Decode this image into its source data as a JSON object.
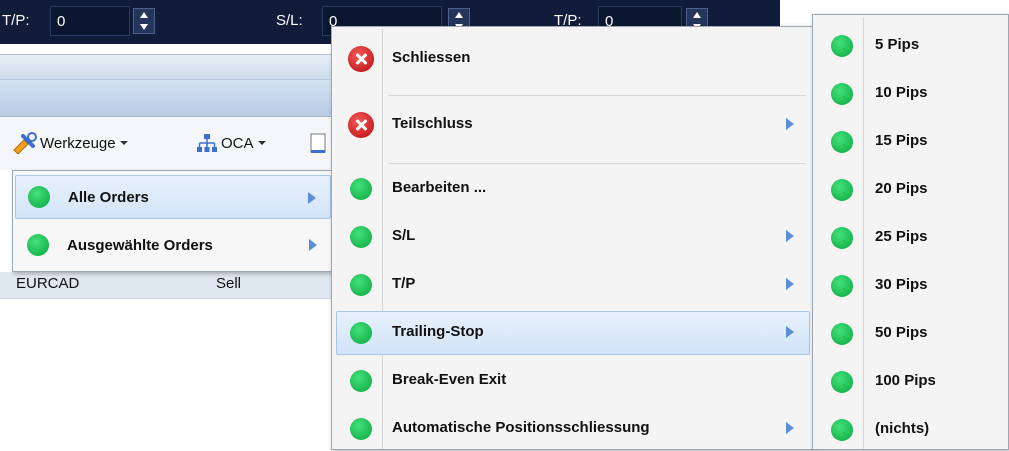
{
  "topbar": {
    "tp_label": "T/P:",
    "tp_value": "0",
    "sl_label": "S/L:",
    "sl_value": "0",
    "tp2_label": "T/P:",
    "tp2_value": "0"
  },
  "toolbar": {
    "tools_label": "Werkzeuge",
    "oca_label": "OCA"
  },
  "left_menu": {
    "items": [
      {
        "label": "Alle Orders",
        "icon": "green-dot-icon",
        "submenu": true,
        "highlighted": true
      },
      {
        "label": "Ausgewählte Orders",
        "icon": "green-dot-icon",
        "submenu": true,
        "highlighted": false
      }
    ]
  },
  "list_row": {
    "symbol": "EURCAD",
    "side": "Sell"
  },
  "center_menu": {
    "items": [
      {
        "label": "Schliessen",
        "icon": "red-x-icon",
        "submenu": false
      },
      {
        "label": "Teilschluss",
        "icon": "red-x-icon",
        "submenu": true
      },
      {
        "label": "Bearbeiten ...",
        "icon": "green-dot-icon",
        "submenu": false
      },
      {
        "label": "S/L",
        "icon": "green-dot-icon",
        "submenu": true
      },
      {
        "label": "T/P",
        "icon": "green-dot-icon",
        "submenu": true
      },
      {
        "label": "Trailing-Stop",
        "icon": "green-dot-icon",
        "submenu": true,
        "highlighted": true
      },
      {
        "label": "Break-Even Exit",
        "icon": "green-dot-icon",
        "submenu": false
      },
      {
        "label": "Automatische Positionsschliessung",
        "icon": "green-dot-icon",
        "submenu": true
      }
    ]
  },
  "right_menu": {
    "items": [
      {
        "label": "5 Pips"
      },
      {
        "label": "10 Pips"
      },
      {
        "label": "15 Pips"
      },
      {
        "label": "20 Pips"
      },
      {
        "label": "25 Pips"
      },
      {
        "label": "30 Pips"
      },
      {
        "label": "50 Pips"
      },
      {
        "label": "100 Pips"
      },
      {
        "label": "(nichts)"
      }
    ]
  },
  "colors": {
    "topbar": "#101c3a",
    "highlight": "#d3e4f8",
    "green_dot": "#1ab851",
    "red_close": "#c81e1e",
    "submenu_arrow": "#5b8ed6"
  }
}
